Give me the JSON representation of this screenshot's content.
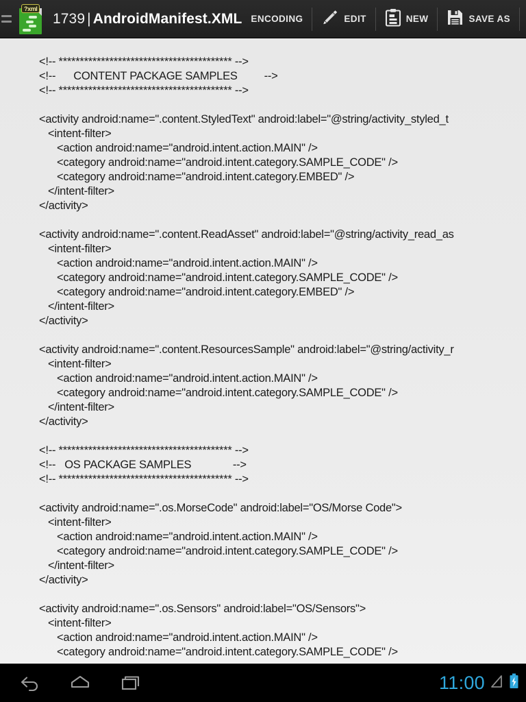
{
  "app": {
    "icon_name": "xml-file-icon",
    "icon_badge": "?xml",
    "menu_icon": "hamburger-menu-icon"
  },
  "header": {
    "file_number": "1739",
    "separator": "|",
    "file_name": "AndroidManifest.XML",
    "actions": [
      {
        "id": "encoding",
        "label": "ENCODING",
        "icon": ""
      },
      {
        "id": "edit",
        "label": "EDIT",
        "icon": "pencil-icon"
      },
      {
        "id": "new",
        "label": "NEW",
        "icon": "clipboard-icon"
      },
      {
        "id": "save-as",
        "label": "SAVE AS",
        "icon": "floppy-disk-icon"
      }
    ],
    "overflow_icon": "overflow-menu-icon"
  },
  "editor": {
    "language": "xml",
    "lines": [
      "<!-- ***************************************** -->",
      "<!--      CONTENT PACKAGE SAMPLES         -->",
      "<!-- ***************************************** -->",
      "",
      "<activity android:name=\".content.StyledText\" android:label=\"@string/activity_styled_t",
      "   <intent-filter>",
      "      <action android:name=\"android.intent.action.MAIN\" />",
      "      <category android:name=\"android.intent.category.SAMPLE_CODE\" />",
      "      <category android:name=\"android.intent.category.EMBED\" />",
      "   </intent-filter>",
      "</activity>",
      "",
      "<activity android:name=\".content.ReadAsset\" android:label=\"@string/activity_read_as",
      "   <intent-filter>",
      "      <action android:name=\"android.intent.action.MAIN\" />",
      "      <category android:name=\"android.intent.category.SAMPLE_CODE\" />",
      "      <category android:name=\"android.intent.category.EMBED\" />",
      "   </intent-filter>",
      "</activity>",
      "",
      "<activity android:name=\".content.ResourcesSample\" android:label=\"@string/activity_r",
      "   <intent-filter>",
      "      <action android:name=\"android.intent.action.MAIN\" />",
      "      <category android:name=\"android.intent.category.SAMPLE_CODE\" />",
      "   </intent-filter>",
      "</activity>",
      "",
      "<!-- ***************************************** -->",
      "<!--   OS PACKAGE SAMPLES              -->",
      "<!-- ***************************************** -->",
      "",
      "<activity android:name=\".os.MorseCode\" android:label=\"OS/Morse Code\">",
      "   <intent-filter>",
      "      <action android:name=\"android.intent.action.MAIN\" />",
      "      <category android:name=\"android.intent.category.SAMPLE_CODE\" />",
      "   </intent-filter>",
      "</activity>",
      "",
      "<activity android:name=\".os.Sensors\" android:label=\"OS/Sensors\">",
      "   <intent-filter>",
      "      <action android:name=\"android.intent.action.MAIN\" />",
      "      <category android:name=\"android.intent.category.SAMPLE_CODE\" />"
    ]
  },
  "navbar": {
    "back_icon": "back-arrow-icon",
    "home_icon": "home-icon",
    "recents_icon": "recent-apps-icon",
    "clock": "11:00",
    "signal_icon": "signal-triangle-icon",
    "battery_icon": "battery-charging-icon",
    "clock_color": "#2fa8dd",
    "battery_color": "#2fa8dd"
  }
}
